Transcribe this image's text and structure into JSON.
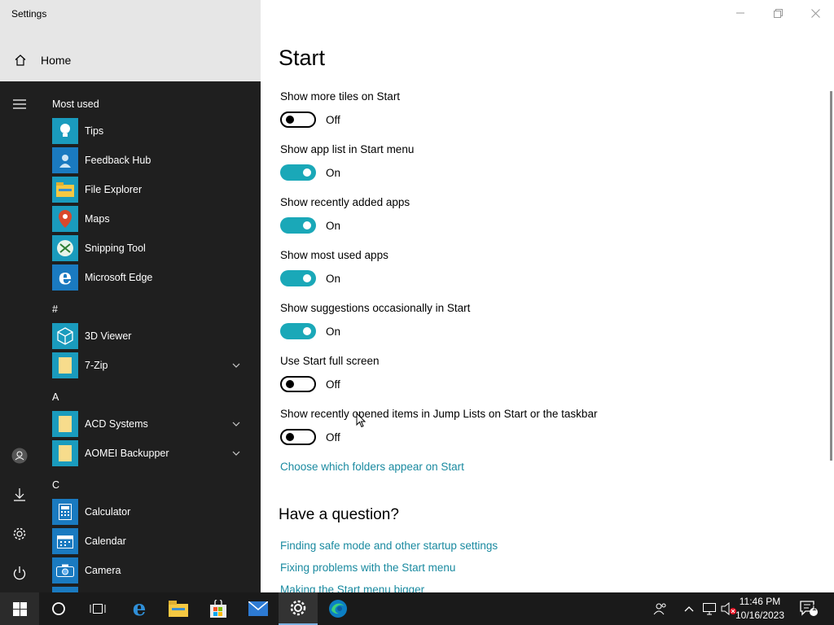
{
  "window": {
    "title": "Settings",
    "home_label": "Home"
  },
  "page": {
    "title": "Start",
    "settings": [
      {
        "label": "Show more tiles on Start",
        "state": "Off",
        "on": false
      },
      {
        "label": "Show app list in Start menu",
        "state": "On",
        "on": true
      },
      {
        "label": "Show recently added apps",
        "state": "On",
        "on": true
      },
      {
        "label": "Show most used apps",
        "state": "On",
        "on": true
      },
      {
        "label": "Show suggestions occasionally in Start",
        "state": "On",
        "on": true
      },
      {
        "label": "Use Start full screen",
        "state": "Off",
        "on": false
      },
      {
        "label": "Show recently opened items in Jump Lists on Start or the taskbar",
        "state": "Off",
        "on": false
      }
    ],
    "folders_link": "Choose which folders appear on Start",
    "question_title": "Have a question?",
    "help_links": [
      "Finding safe mode and other startup settings",
      "Fixing problems with the Start menu",
      "Making the Start menu bigger"
    ]
  },
  "start_menu": {
    "most_used_header": "Most used",
    "most_used": [
      {
        "name": "Tips",
        "icon": "tips-icon"
      },
      {
        "name": "Feedback Hub",
        "icon": "feedback-hub-icon"
      },
      {
        "name": "File Explorer",
        "icon": "file-explorer-icon"
      },
      {
        "name": "Maps",
        "icon": "maps-icon"
      },
      {
        "name": "Snipping Tool",
        "icon": "snipping-tool-icon"
      },
      {
        "name": "Microsoft Edge",
        "icon": "edge-icon"
      }
    ],
    "groups": [
      {
        "letter": "#",
        "apps": [
          {
            "name": "3D Viewer",
            "icon": "3d-viewer-icon",
            "expandable": false
          },
          {
            "name": "7-Zip",
            "icon": "folder-icon",
            "expandable": true
          }
        ]
      },
      {
        "letter": "A",
        "apps": [
          {
            "name": "ACD Systems",
            "icon": "folder-icon",
            "expandable": true
          },
          {
            "name": "AOMEI Backupper",
            "icon": "folder-icon",
            "expandable": true
          }
        ]
      },
      {
        "letter": "C",
        "apps": [
          {
            "name": "Calculator",
            "icon": "calculator-icon",
            "expandable": false
          },
          {
            "name": "Calendar",
            "icon": "calendar-icon",
            "expandable": false
          },
          {
            "name": "Camera",
            "icon": "camera-icon",
            "expandable": false
          }
        ]
      }
    ]
  },
  "taskbar": {
    "time": "11:46 PM",
    "date": "10/16/2023",
    "notification_count": "1"
  },
  "colors": {
    "accent": "#1aa8b8",
    "link": "#1a8aa0",
    "start_bg": "#1f1f1f",
    "tile": "#1a9bbd"
  }
}
